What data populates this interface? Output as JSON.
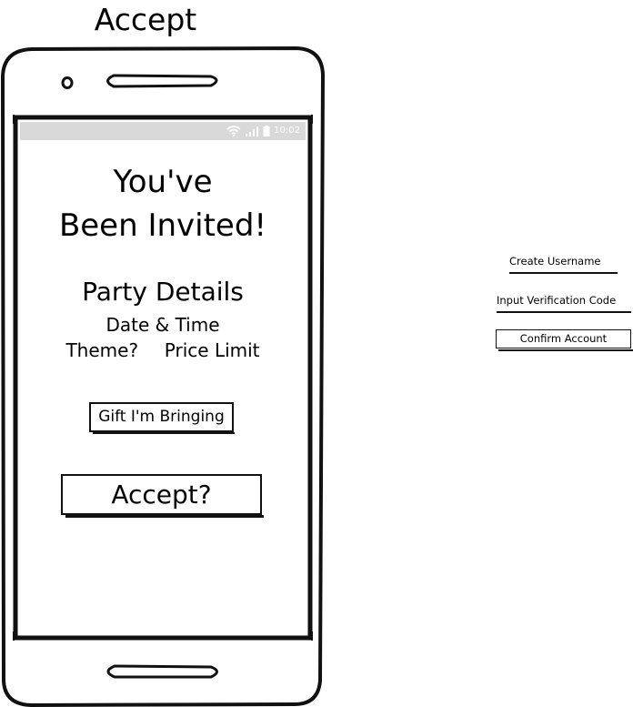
{
  "page": {
    "title": "Accept"
  },
  "phone": {
    "status_time": "10:02",
    "icons": {
      "wifi": "wifi-icon",
      "signal": "signal-icon",
      "battery": "battery-icon",
      "camera": "camera-icon",
      "speaker": "speaker-icon",
      "home": "home-button"
    },
    "invite": {
      "line1": "You've",
      "line2": "Been Invited!"
    },
    "details": {
      "title": "Party Details",
      "date_time": "Date & Time",
      "theme": "Theme?",
      "price_limit": "Price Limit"
    },
    "gift_button_label": "Gift I'm Bringing",
    "accept_button_label": "Accept?"
  },
  "account_form": {
    "create_username": "Create Username",
    "verification_code": "Input Verification Code",
    "confirm_button_label": "Confirm Account"
  },
  "colors": {
    "status_bar": "#d9d9d9",
    "stroke": "#111111",
    "background": "#ffffff"
  }
}
